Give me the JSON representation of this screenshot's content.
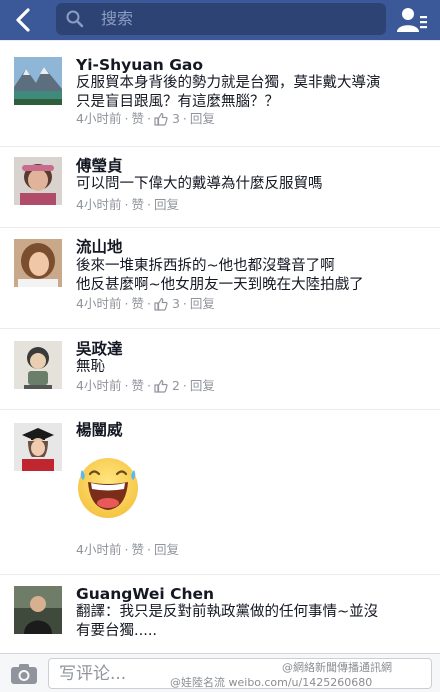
{
  "header": {
    "search_placeholder": "搜索"
  },
  "comments": [
    {
      "name": "Yi-Shyuan Gao",
      "lines": [
        "反服貿本身背後的勢力就是台獨，莫非戴大導演",
        "只是盲目跟風？有這麼無腦？？"
      ],
      "time": "4小时前",
      "like": "赞",
      "like_count": "3",
      "reply": "回复"
    },
    {
      "name": "傅瑩貞",
      "lines": [
        "可以問一下偉大的戴導為什麼反服貿嗎"
      ],
      "time": "4小时前",
      "like": "赞",
      "like_count": "",
      "reply": "回复"
    },
    {
      "name": "流山地",
      "lines": [
        "後來一堆東拆西拆的~他也都沒聲音了啊",
        "他反甚麼啊~他女朋友一天到晚在大陸拍戲了"
      ],
      "time": "4小时前",
      "like": "赞",
      "like_count": "3",
      "reply": "回复"
    },
    {
      "name": "吳政達",
      "lines": [
        "無恥"
      ],
      "time": "4小时前",
      "like": "赞",
      "like_count": "2",
      "reply": "回复"
    },
    {
      "name": "楊闓威",
      "lines": [],
      "time": "4小时前",
      "like": "赞",
      "like_count": "",
      "reply": "回复"
    },
    {
      "name": "GuangWei Chen",
      "lines": [
        "翻譯：我只是反對前執政黨做的任何事情~並沒",
        "有要台獨....."
      ],
      "time": "",
      "like": "",
      "like_count": "",
      "reply": ""
    }
  ],
  "composer": {
    "placeholder": "写评论..."
  },
  "watermarks": {
    "line1": "@網絡新聞傳播通訊網",
    "line2": "@娃陸名流 weibo.com/u/1425260680"
  },
  "colors": {
    "brand": "#3b5998",
    "meta_text": "#90949c",
    "like_blue": "#4267b2",
    "divider": "#e9ebee"
  }
}
